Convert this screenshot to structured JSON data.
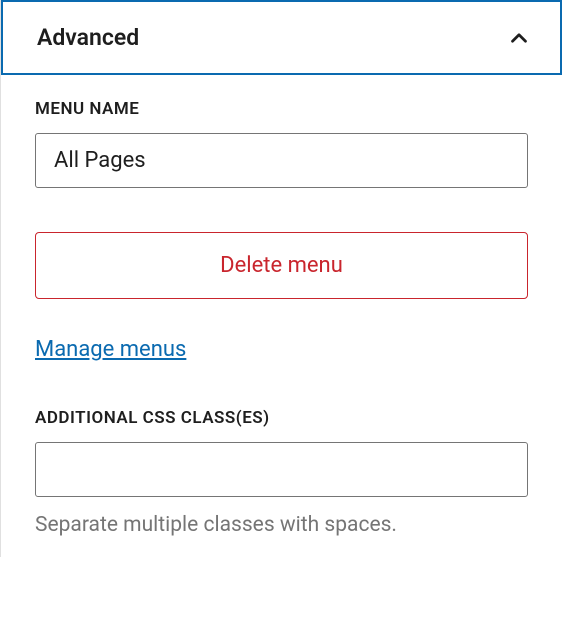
{
  "panel": {
    "title": "Advanced"
  },
  "menuName": {
    "label": "MENU NAME",
    "value": "All Pages"
  },
  "deleteButton": {
    "label": "Delete menu"
  },
  "manageLink": {
    "label": "Manage menus"
  },
  "cssClasses": {
    "label": "ADDITIONAL CSS CLASS(ES)",
    "value": "",
    "help": "Separate multiple classes with spaces."
  }
}
